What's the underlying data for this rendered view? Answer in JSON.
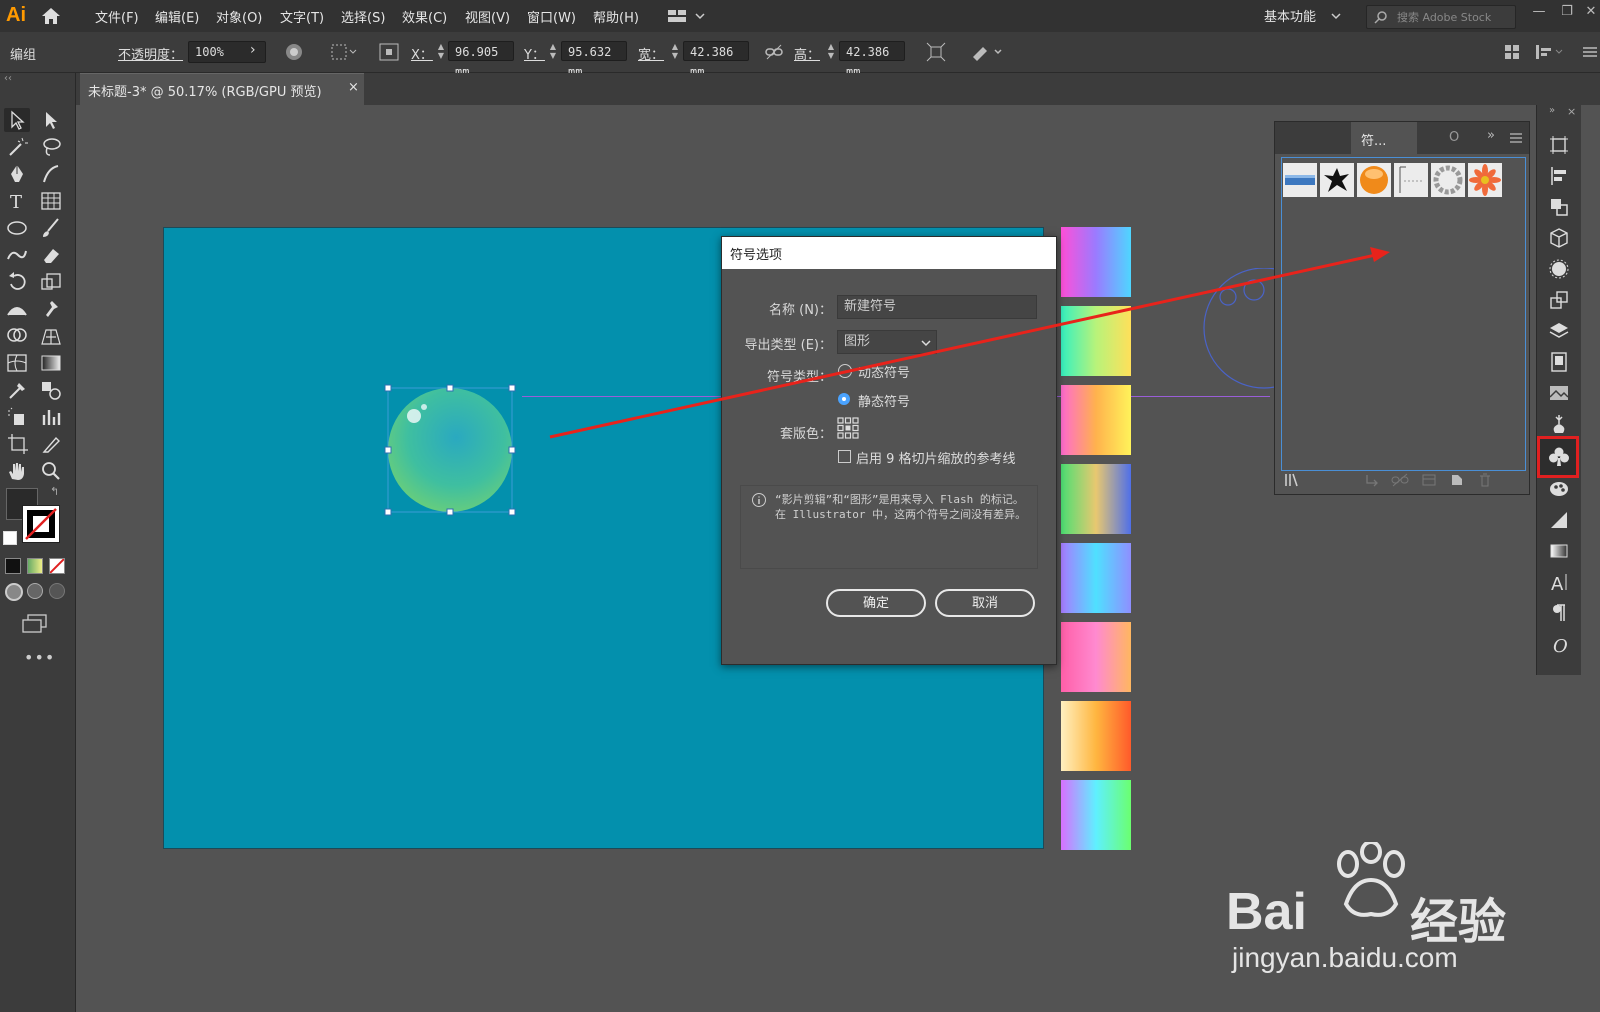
{
  "app": {
    "logo": "Ai"
  },
  "menu": [
    "文件(F)",
    "编辑(E)",
    "对象(O)",
    "文字(T)",
    "选择(S)",
    "效果(C)",
    "视图(V)",
    "窗口(W)",
    "帮助(H)"
  ],
  "workspace": "基本功能",
  "stock_search_placeholder": "搜索 Adobe Stock",
  "control_bar": {
    "selection_type": "编组",
    "opacity_label": "不透明度：",
    "opacity_value": "100%",
    "x_label": "X：",
    "x_value": "96.905 mm",
    "y_label": "Y：",
    "y_value": "95.632 mm",
    "w_label": "宽：",
    "w_value": "42.386 mm",
    "h_label": "高：",
    "h_value": "42.386 mm"
  },
  "document_tab": {
    "title": "未标题-3* @ 50.17% (RGB/GPU 预览)",
    "close": "×"
  },
  "dialog": {
    "title": "符号选项",
    "name_label": "名称 (N)：",
    "name_value": "新建符号",
    "export_type_label": "导出类型 (E)：",
    "export_type_value": "图形",
    "symbol_type_label": "符号类型：",
    "dynamic_symbol": "动态符号",
    "static_symbol": "静态符号",
    "selected_symbol_type": "static",
    "registration_label": "套版色：",
    "nine_slice_label": "启用 9 格切片缩放的参考线",
    "nine_slice_checked": false,
    "info_text": "“影片剪辑”和“图形”是用来导入 Flash 的标记。在 Illustrator 中，这两个符号之间没有差异。",
    "ok": "确定",
    "cancel": "取消"
  },
  "symbols_panel": {
    "tab_label": "符...",
    "other_tab": "O"
  },
  "watermark": {
    "brand": "Bai",
    "brand_cn": "经验",
    "url": "jingyan.baidu.com"
  },
  "colors": {
    "artboard": "#0390ad",
    "highlight": "#e02020",
    "arrow": "#e8231b",
    "menubar": "#323232",
    "panel": "#535353"
  }
}
